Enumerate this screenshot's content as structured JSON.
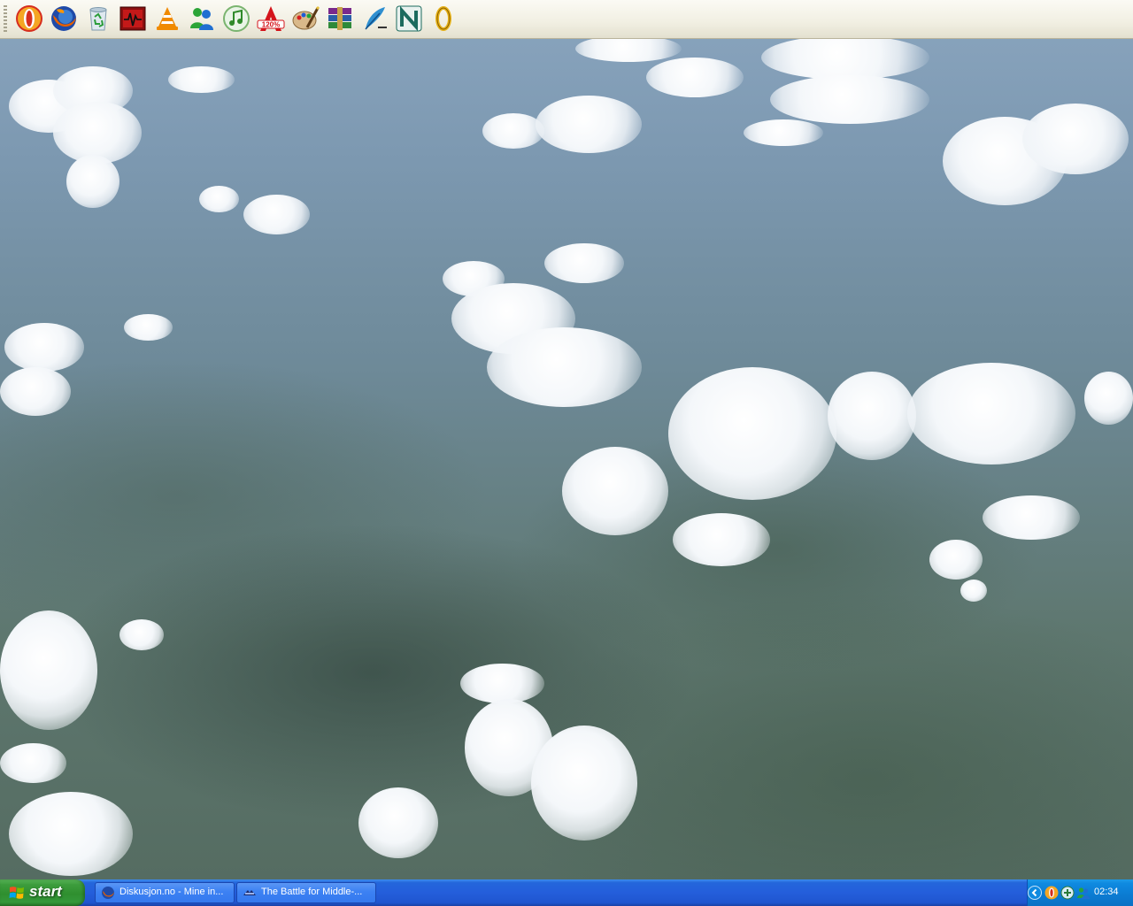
{
  "quick_launch": {
    "icons": [
      "opera-icon",
      "firefox-icon",
      "recycle-bin-icon",
      "audio-monitor-icon",
      "vlc-icon",
      "msn-messenger-icon",
      "itunes-icon",
      "alcohol-120-icon",
      "paint-icon",
      "winrar-icon",
      "feather-writer-icon",
      "nero-icon",
      "ring-icon"
    ]
  },
  "taskbar": {
    "start_label": "start",
    "tasks": [
      {
        "label": "Diskusjon.no - Mine in...",
        "icon": "firefox-icon"
      },
      {
        "label": "The Battle for Middle-...",
        "icon": "game-ea-icon"
      }
    ],
    "tray": {
      "icons": [
        "show-hidden-icons-chevron",
        "opera-tray-icon",
        "network-tray-icon",
        "msn-tray-icon"
      ],
      "clock": "02:34"
    }
  },
  "colors": {
    "taskbar_blue": "#245edb",
    "start_green": "#3c9c3c",
    "tray_blue": "#0b7bd2",
    "toolbar_bg": "#f1efe2"
  }
}
